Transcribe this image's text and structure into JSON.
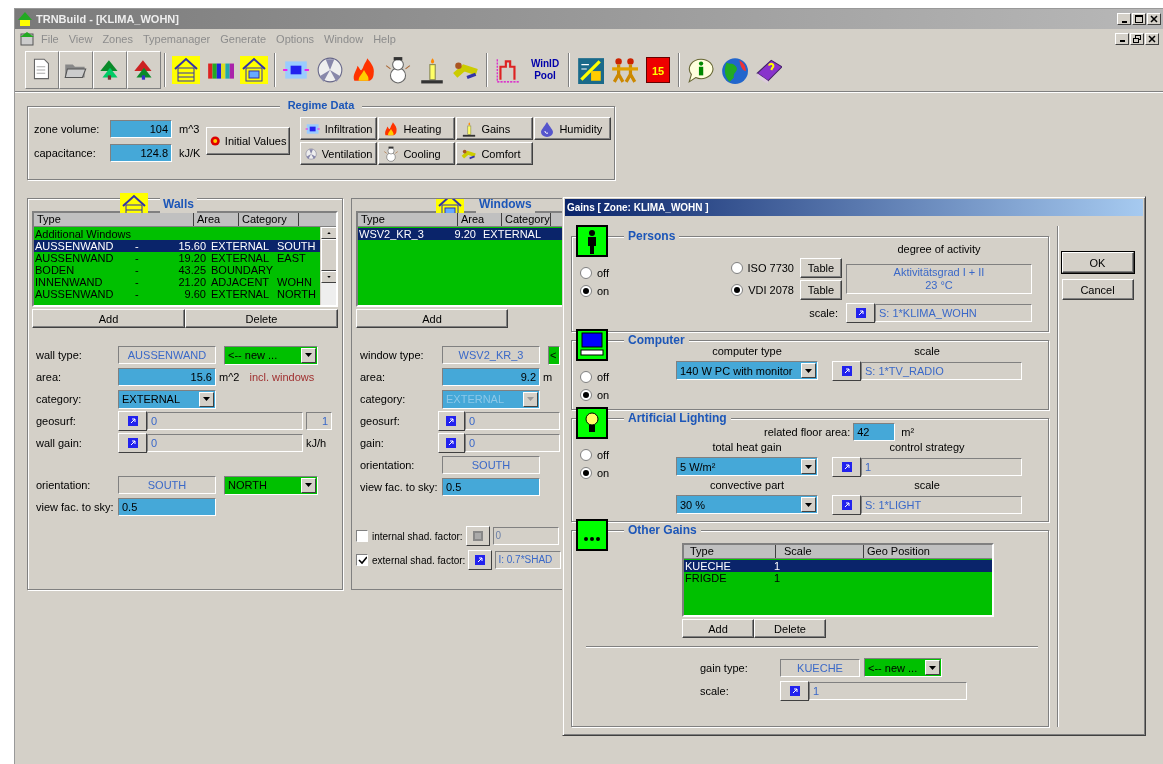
{
  "window": {
    "title": "TRNBuild - [KLIMA_WOHN]"
  },
  "menu": [
    "File",
    "View",
    "Zones",
    "Typemanager",
    "Generate",
    "Options",
    "Window",
    "Help"
  ],
  "toolbar": {
    "pool_label": "WinID Pool",
    "calendar_label": "15"
  },
  "regime": {
    "title": "Regime Data",
    "fields": [
      {
        "label": "zone volume:",
        "value": "104",
        "unit": "m^3"
      },
      {
        "label": "capacitance:",
        "value": "124.8",
        "unit": "kJ/K"
      }
    ],
    "initial_values": "Initial Values",
    "buttons": [
      {
        "kind": "infiltration",
        "label": "Infiltration"
      },
      {
        "kind": "heating",
        "label": "Heating"
      },
      {
        "kind": "gains",
        "label": "Gains"
      },
      {
        "kind": "humidity",
        "label": "Humidity"
      },
      {
        "kind": "ventilation",
        "label": "Ventilation"
      },
      {
        "kind": "cooling",
        "label": "Cooling"
      },
      {
        "kind": "comfort",
        "label": "Comfort"
      }
    ]
  },
  "walls": {
    "title": "Walls",
    "columns": [
      "Type",
      "Area",
      "Category"
    ],
    "rows": [
      {
        "cells": [
          "Additional Windows"
        ],
        "selected": false
      },
      {
        "cells": [
          "AUSSENWAND",
          "-",
          "15.60",
          "EXTERNAL",
          "SOUTH"
        ],
        "selected": true
      },
      {
        "cells": [
          "AUSSENWAND",
          "-",
          "19.20",
          "EXTERNAL",
          "EAST"
        ],
        "selected": false
      },
      {
        "cells": [
          "BODEN",
          "-",
          "43.25",
          "BOUNDARY"
        ],
        "selected": false
      },
      {
        "cells": [
          "INNENWAND",
          "-",
          "21.20",
          "ADJACENT",
          "WOHN"
        ],
        "selected": false
      },
      {
        "cells": [
          "AUSSENWAND",
          "-",
          "9.60",
          "EXTERNAL",
          "NORTH"
        ],
        "selected": false
      }
    ],
    "buttons": [
      "Add",
      "Delete"
    ],
    "fields": [
      {
        "kind": "type",
        "label": "wall type:",
        "value": "AUSSENWAND",
        "combo": "<-- new ..."
      },
      {
        "kind": "number",
        "label": "area:",
        "value": "15.6",
        "unit": "m^2",
        "note": "incl. windows"
      },
      {
        "kind": "combo",
        "label": "category:",
        "value": "EXTERNAL",
        "disabled": false
      },
      {
        "kind": "link",
        "label": "geosurf:",
        "value": "0",
        "extra": "1"
      },
      {
        "kind": "link",
        "label": "wall gain:",
        "value": "0",
        "unit": "kJ/h"
      }
    ],
    "fields_lower": [
      {
        "kind": "type",
        "label": "orientation:",
        "value": "SOUTH",
        "combo": "NORTH"
      },
      {
        "kind": "text",
        "label": "view fac. to sky:",
        "value": "0.5"
      }
    ]
  },
  "windows": {
    "title": "Windows",
    "columns": [
      "Type",
      "Area",
      "Category"
    ],
    "rows": [
      {
        "cells": [
          "WSV2_KR_3",
          "9.20",
          "EXTERNAL"
        ],
        "selected": true
      }
    ],
    "buttons": [
      "Add"
    ],
    "fields": [
      {
        "kind": "type",
        "label": "window type:",
        "value": "WSV2_KR_3",
        "combo": "<"
      },
      {
        "kind": "number",
        "label": "area:",
        "value": "9.2",
        "unit": "m"
      },
      {
        "kind": "combo",
        "label": "category:",
        "value": "EXTERNAL",
        "disabled": true
      },
      {
        "kind": "link",
        "label": "geosurf:",
        "value": "0"
      },
      {
        "kind": "link",
        "label": "gain:",
        "value": "0"
      },
      {
        "kind": "type",
        "label": "orientation:",
        "value": "SOUTH"
      },
      {
        "kind": "text",
        "label": "view fac. to sky:",
        "value": "0.5"
      }
    ],
    "shading": [
      {
        "label": "internal shad. factor:",
        "checked": false,
        "value": "0"
      },
      {
        "label": "external shad. factor:",
        "checked": true,
        "value": "I: 0.7*SHAD"
      }
    ]
  },
  "dialog": {
    "title": "Gains [ Zone: KLIMA_WOHN ]",
    "persons": {
      "title": "Persons",
      "switch": [
        {
          "label": "off",
          "selected": false
        },
        {
          "label": "on",
          "selected": true
        }
      ],
      "standards": [
        {
          "label": "ISO 7730",
          "selected": false,
          "button": "Table"
        },
        {
          "label": "VDI 2078",
          "selected": true,
          "button": "Table"
        }
      ],
      "activity_label": "degree of activity",
      "activity_lines": [
        "Aktivitätsgrad I + II",
        "23 °C"
      ],
      "scale_label": "scale:",
      "scale": "S: 1*KLIMA_WOHN"
    },
    "computer": {
      "title": "Computer",
      "switch": [
        {
          "label": "off",
          "selected": false
        },
        {
          "label": "on",
          "selected": true
        }
      ],
      "type_label": "computer type",
      "type": "140 W  PC with monitor",
      "scale_label": "scale",
      "scale": "S: 1*TV_RADIO"
    },
    "lighting": {
      "title": "Artificial Lighting",
      "switch": [
        {
          "label": "off",
          "selected": false
        },
        {
          "label": "on",
          "selected": true
        }
      ],
      "area_label": "related floor area:",
      "area": "42",
      "area_unit": "m²",
      "heat_label": "total heat gain",
      "heat": "5  W/m²",
      "control_label": "control strategy",
      "control": "1",
      "convective_label": "convective part",
      "convective": "30  %",
      "scale_label": "scale",
      "scale": "S: 1*LIGHT"
    },
    "other": {
      "title": "Other Gains",
      "columns": [
        "Type",
        "Scale",
        "Geo Position"
      ],
      "rows": [
        {
          "cells": [
            "KUECHE",
            "1"
          ],
          "selected": true
        },
        {
          "cells": [
            "FRIGDE",
            "1"
          ],
          "selected": false
        }
      ],
      "buttons": [
        "Add",
        "Delete"
      ],
      "type_label": "gain type:",
      "type": "KUECHE",
      "combo": "<-- new ...",
      "scale_label": "scale:",
      "scale": "1"
    },
    "buttons": [
      {
        "label": "OK",
        "default": true
      },
      {
        "label": "Cancel",
        "default": false
      }
    ]
  }
}
